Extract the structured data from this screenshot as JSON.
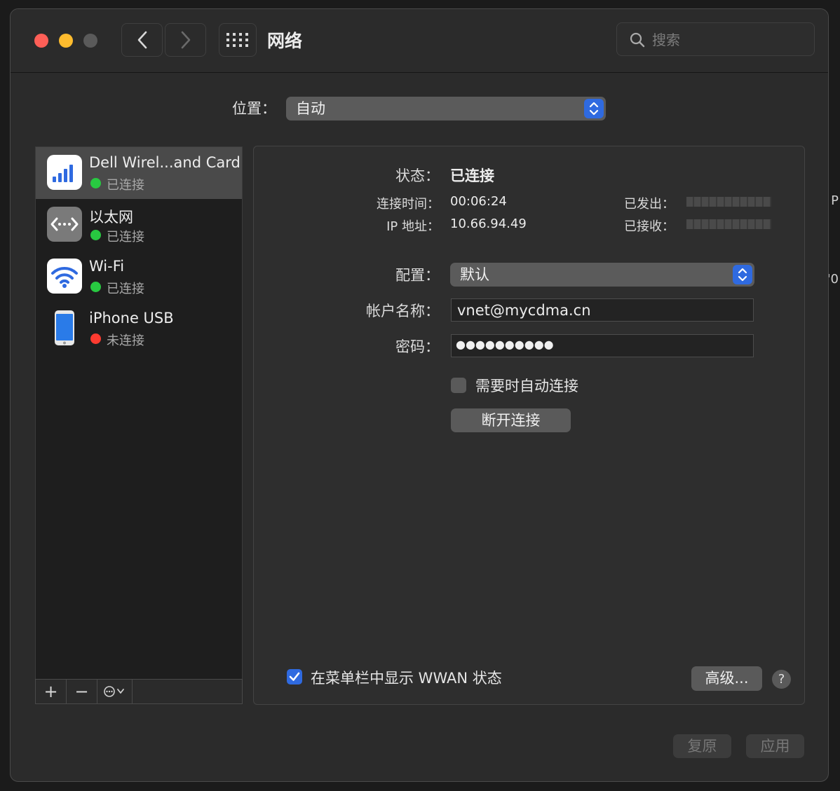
{
  "window": {
    "title": "网络"
  },
  "search": {
    "placeholder": "搜索"
  },
  "location": {
    "label": "位置：",
    "value": "自动"
  },
  "services": [
    {
      "name": "Dell Wirel...and Card",
      "status": "已连接",
      "status_color": "#28c941",
      "icon": "cellular-icon",
      "selected": true
    },
    {
      "name": "以太网",
      "status": "已连接",
      "status_color": "#28c941",
      "icon": "ethernet-icon",
      "selected": false
    },
    {
      "name": "Wi-Fi",
      "status": "已连接",
      "status_color": "#28c941",
      "icon": "wifi-icon",
      "selected": false
    },
    {
      "name": "iPhone USB",
      "status": "未连接",
      "status_color": "#fe3b30",
      "icon": "iphone-icon",
      "selected": false
    }
  ],
  "sidebar_buttons": {
    "add": "+",
    "remove": "−"
  },
  "details": {
    "status_label": "状态：",
    "status_value": "已连接",
    "connect_time_label": "连接时间：",
    "connect_time_value": "00:06:24",
    "ip_label": "IP 地址：",
    "ip_value": "10.66.94.49",
    "sent_label": "已发出：",
    "received_label": "已接收：",
    "config_label": "配置：",
    "config_value": "默认",
    "account_label": "帐户名称：",
    "account_value": "vnet@mycdma.cn",
    "password_label": "密码：",
    "password_value": "●●●●●●●●●●",
    "auto_connect_label": "需要时自动连接",
    "auto_connect_checked": false,
    "disconnect_button": "断开连接",
    "show_menu_label": "在菜单栏中显示 WWAN 状态",
    "show_menu_checked": true,
    "advanced_button": "高级...",
    "help_button": "?"
  },
  "footer": {
    "revert_button": "复原",
    "apply_button": "应用"
  },
  "edge": {
    "text1": "P",
    "text2": "'0"
  },
  "colors": {
    "accent": "#2f6ae0",
    "connected": "#28c941",
    "disconnected": "#fe3b30"
  }
}
